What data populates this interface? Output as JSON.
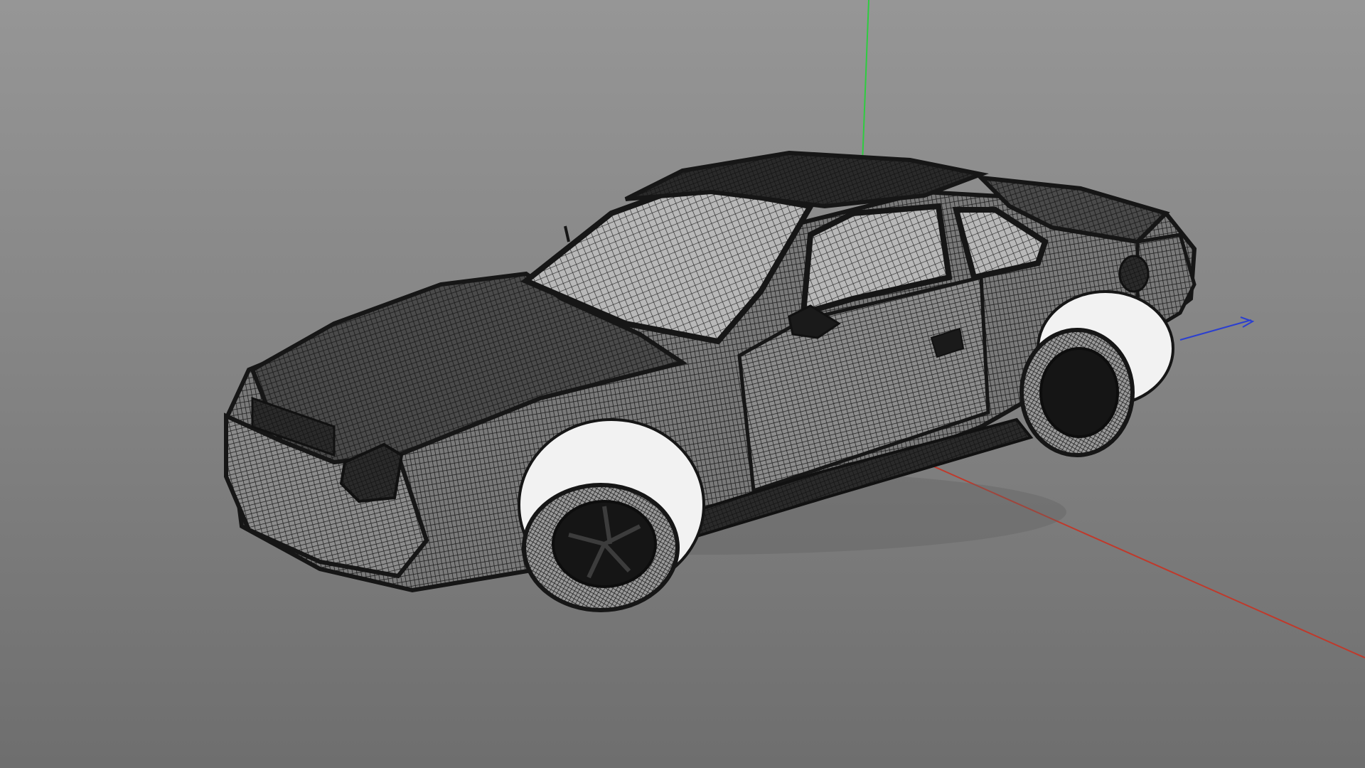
{
  "viewport": {
    "background_top": "#969696",
    "background_bottom": "#6e6e6e",
    "render_mode": "wireframe"
  },
  "axes": {
    "x_color": "#c0392b",
    "y_color": "#2ecc40",
    "z_color": "#2b3fd0"
  },
  "model": {
    "wire_color": "#1c1c1c",
    "panel_color": "#c8c8c8",
    "body_fill": "#3a3a3a"
  }
}
